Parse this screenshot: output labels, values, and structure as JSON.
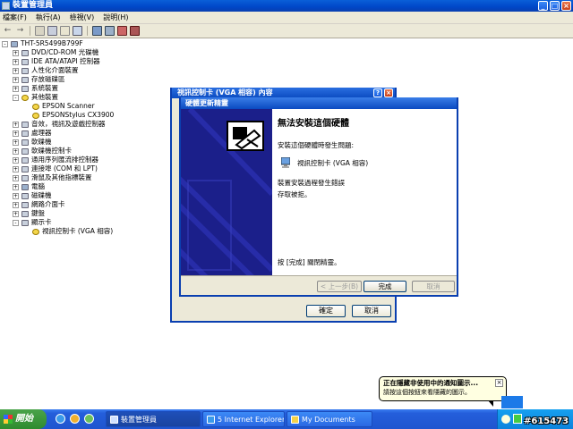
{
  "window": {
    "title": "裝置管理員",
    "menus": [
      "檔案(F)",
      "執行(A)",
      "檢視(V)",
      "說明(H)"
    ]
  },
  "tree": {
    "items": [
      {
        "label": "THT-5R5499B799F",
        "level": 0,
        "expander": "-",
        "icon": "computer-icon"
      },
      {
        "label": "DVD/CD-ROM 光碟機",
        "level": 1,
        "expander": "+",
        "icon": "cdrom-icon"
      },
      {
        "label": "IDE ATA/ATAPI 控制器",
        "level": 1,
        "expander": "+",
        "icon": "ide-controller-icon"
      },
      {
        "label": "人性化介面裝置",
        "level": 1,
        "expander": "+",
        "icon": "hid-icon"
      },
      {
        "label": "存放磁碟區",
        "level": 1,
        "expander": "+",
        "icon": "volume-icon"
      },
      {
        "label": "系統裝置",
        "level": 1,
        "expander": "+",
        "icon": "system-device-icon"
      },
      {
        "label": "其他裝置",
        "level": 1,
        "expander": "-",
        "icon": "warning-icon"
      },
      {
        "label": "EPSON Scanner",
        "level": 2,
        "expander": "",
        "icon": "warning-icon"
      },
      {
        "label": "EPSONStylus CX3900",
        "level": 2,
        "expander": "",
        "icon": "warning-icon"
      },
      {
        "label": "音效，視訊及遊戲控制器",
        "level": 1,
        "expander": "+",
        "icon": "sound-icon"
      },
      {
        "label": "處理器",
        "level": 1,
        "expander": "+",
        "icon": "processor-icon"
      },
      {
        "label": "軟碟機",
        "level": 1,
        "expander": "+",
        "icon": "floppy-icon"
      },
      {
        "label": "軟碟機控制卡",
        "level": 1,
        "expander": "+",
        "icon": "floppy-controller-icon"
      },
      {
        "label": "通用序列匯流排控制器",
        "level": 1,
        "expander": "+",
        "icon": "usb-icon"
      },
      {
        "label": "連接埠 (COM 和 LPT)",
        "level": 1,
        "expander": "+",
        "icon": "port-icon"
      },
      {
        "label": "滑鼠及其他指標裝置",
        "level": 1,
        "expander": "+",
        "icon": "mouse-icon"
      },
      {
        "label": "電腦",
        "level": 1,
        "expander": "+",
        "icon": "computer-icon"
      },
      {
        "label": "磁碟機",
        "level": 1,
        "expander": "+",
        "icon": "disk-icon"
      },
      {
        "label": "網路介面卡",
        "level": 1,
        "expander": "+",
        "icon": "network-icon"
      },
      {
        "label": "鍵盤",
        "level": 1,
        "expander": "+",
        "icon": "keyboard-icon"
      },
      {
        "label": "顯示卡",
        "level": 1,
        "expander": "-",
        "icon": "display-icon"
      },
      {
        "label": "視訊控制卡 (VGA 相容)",
        "level": 2,
        "expander": "",
        "icon": "warning-icon"
      }
    ]
  },
  "properties_dialog": {
    "title": "視訊控制卡 (VGA 相容) 內容",
    "ok": "確定",
    "cancel": "取消"
  },
  "wizard": {
    "title": "硬體更新精靈",
    "heading": "無法安裝這個硬體",
    "problem_text": "安裝這個硬體時發生問題:",
    "device_name": "視訊控制卡 (VGA 相容)",
    "error_text": "裝置安裝過程發生錯誤",
    "denied_text": "存取被拒。",
    "finish_text": "按 [完成] 關閉精靈。",
    "back": "< 上一步(B)",
    "finish": "完成",
    "cancel": "取消"
  },
  "balloon": {
    "title": "正在隱藏非使用中的通知圖示...",
    "body": "請按這個按鈕來看隱藏的圖示。"
  },
  "taskbar": {
    "start": "開始",
    "buttons": [
      "裝置管理員",
      "5 Internet Explorer",
      "My Documents"
    ]
  },
  "watermark": "#615473"
}
